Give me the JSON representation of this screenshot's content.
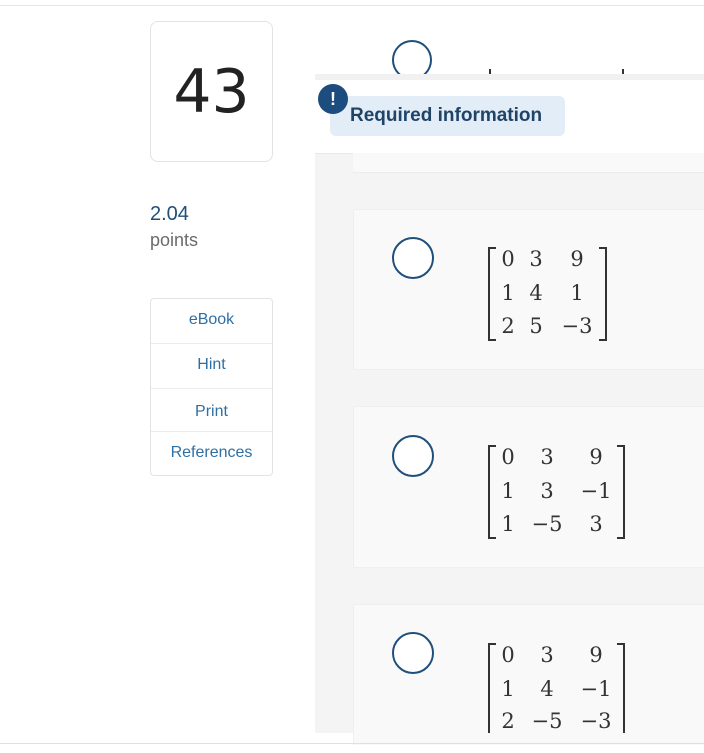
{
  "question": {
    "number": "43",
    "points_value": "2.04",
    "points_label": "points"
  },
  "tools": [
    "eBook",
    "Hint",
    "Print",
    "References"
  ],
  "notice": {
    "icon": "!",
    "text": "Required information"
  },
  "options": [
    {
      "matrix": [
        [
          "0",
          "3",
          "9"
        ],
        [
          "1",
          "4",
          "1"
        ],
        [
          "2",
          "5",
          "−3"
        ]
      ]
    },
    {
      "matrix": [
        [
          "0",
          "3",
          "9"
        ],
        [
          "1",
          "3",
          "−1"
        ],
        [
          "1",
          "−5",
          "3"
        ]
      ]
    },
    {
      "matrix": [
        [
          "0",
          "3",
          "9"
        ],
        [
          "1",
          "4",
          "−1"
        ],
        [
          "2",
          "−5",
          "−3"
        ]
      ]
    }
  ],
  "colors": {
    "accent": "#1f4f7a",
    "link": "#2f6fa3",
    "notice_bg": "#e3edf7"
  }
}
